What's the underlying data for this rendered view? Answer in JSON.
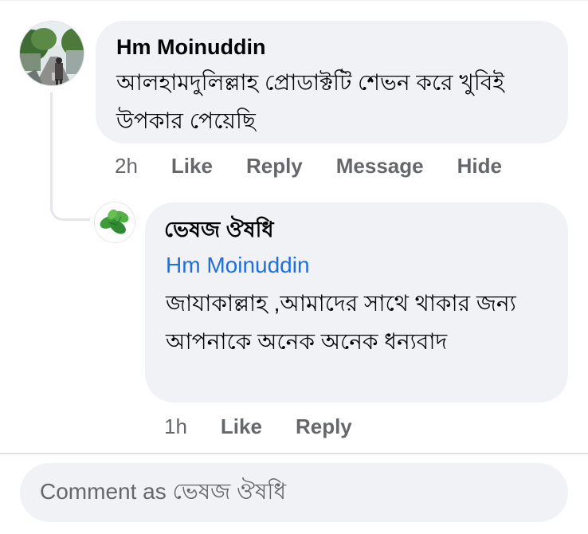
{
  "comment": {
    "author": "Hm Moinuddin",
    "text": "আলহামদুলিল্লাহ প্রোডাক্টটি শেভন করে খুবিই উপকার পেয়েছি",
    "time": "2h",
    "actions": [
      "Like",
      "Reply",
      "Message",
      "Hide"
    ]
  },
  "reply": {
    "author": "ভেষজ ঔষধি",
    "mention": "Hm Moinuddin",
    "text": "জাযাকাল্লাহ ,আমাদের সাথে থাকার জন্য আপনাকে অনেক অনেক ধন্যবাদ",
    "time": "1h",
    "actions": [
      "Like",
      "Reply"
    ]
  },
  "composer": {
    "placeholder": "Comment as ভেষজ ঔষধি"
  },
  "colors": {
    "bubble": "#f0f2f5",
    "mention": "#216fdb",
    "secondary_text": "#65676b"
  }
}
